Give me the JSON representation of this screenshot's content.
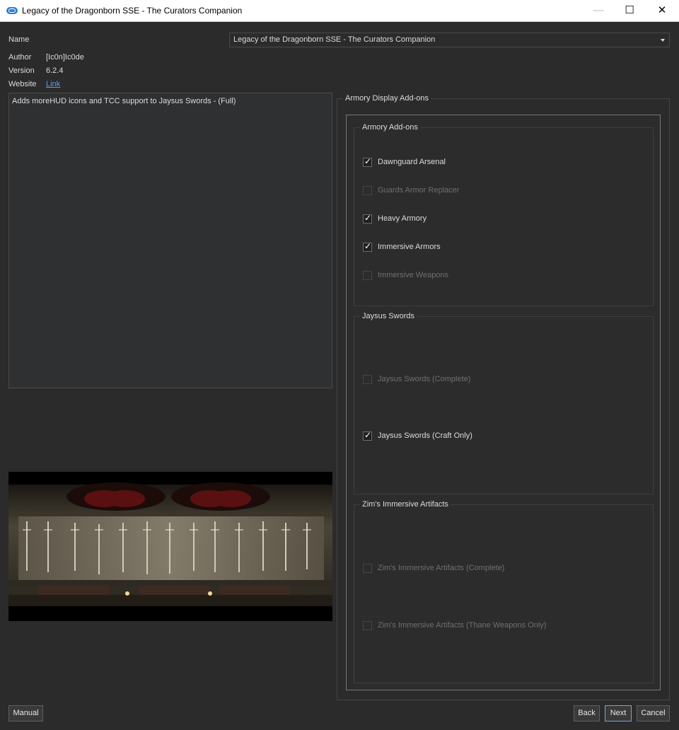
{
  "window": {
    "title": "Legacy of the Dragonborn SSE - The Curators Companion",
    "minimize_glyph": "—",
    "maximize_glyph": "☐",
    "close_glyph": "✕",
    "icon": "app-icon"
  },
  "info": {
    "name_label": "Name",
    "name_value": "Legacy of the Dragonborn SSE - The Curators Companion",
    "author_label": "Author",
    "author_value": "[Ic0n]Ic0de",
    "version_label": "Version",
    "version_value": "6.2.4",
    "website_label": "Website",
    "website_link": "Link"
  },
  "description": "Adds moreHUD icons and TCC support to Jaysus Swords - (Full)",
  "step_group_title": "Armory Display Add-ons",
  "groups": [
    {
      "title": "Armory Add-ons",
      "options": [
        {
          "label": "Dawnguard Arsenal",
          "checked": true,
          "enabled": true
        },
        {
          "label": "Guards Armor Replacer",
          "checked": false,
          "enabled": false
        },
        {
          "label": "Heavy Armory",
          "checked": true,
          "enabled": true
        },
        {
          "label": "Immersive Armors",
          "checked": true,
          "enabled": true
        },
        {
          "label": "Immersive Weapons",
          "checked": false,
          "enabled": false
        }
      ]
    },
    {
      "title": "Jaysus Swords",
      "options": [
        {
          "label": "Jaysus Swords (Complete)",
          "checked": false,
          "enabled": false
        },
        {
          "label": "Jaysus Swords (Craft Only)",
          "checked": true,
          "enabled": true
        }
      ]
    },
    {
      "title": "Zim's Immersive Artifacts",
      "options": [
        {
          "label": "Zim's Immersive Artifacts (Complete)",
          "checked": false,
          "enabled": false
        },
        {
          "label": "Zim's Immersive Artifacts (Thane Weapons Only)",
          "checked": false,
          "enabled": false
        }
      ]
    }
  ],
  "buttons": {
    "manual": "Manual",
    "back": "Back",
    "next": "Next",
    "cancel": "Cancel"
  }
}
